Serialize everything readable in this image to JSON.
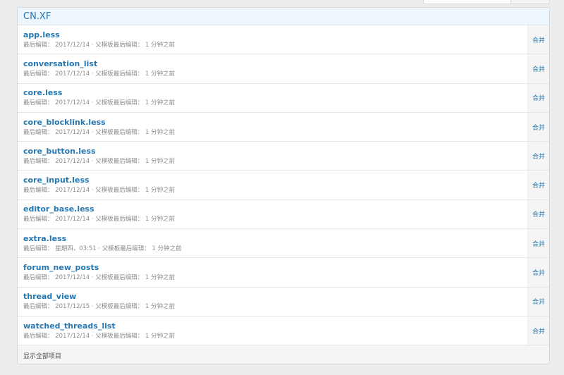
{
  "block": {
    "title": "CN.XF",
    "footer_link": "显示全部项目"
  },
  "items": [
    {
      "name": "app.less",
      "meta": "最后编辑： 2017/12/14 · 父模板最后编辑： 1 分钟之前",
      "action": "合并"
    },
    {
      "name": "conversation_list",
      "meta": "最后编辑： 2017/12/14 · 父模板最后编辑： 1 分钟之前",
      "action": "合并"
    },
    {
      "name": "core.less",
      "meta": "最后编辑： 2017/12/14 · 父模板最后编辑： 1 分钟之前",
      "action": "合并"
    },
    {
      "name": "core_blocklink.less",
      "meta": "最后编辑： 2017/12/14 · 父模板最后编辑： 1 分钟之前",
      "action": "合并"
    },
    {
      "name": "core_button.less",
      "meta": "最后编辑： 2017/12/14 · 父模板最后编辑： 1 分钟之前",
      "action": "合并"
    },
    {
      "name": "core_input.less",
      "meta": "最后编辑： 2017/12/14 · 父模板最后编辑： 1 分钟之前",
      "action": "合并"
    },
    {
      "name": "editor_base.less",
      "meta": "最后编辑： 2017/12/14 · 父模板最后编辑： 1 分钟之前",
      "action": "合并"
    },
    {
      "name": "extra.less",
      "meta": "最后编辑： 星期四，03:51 · 父模板最后编辑： 1 分钟之前",
      "action": "合并"
    },
    {
      "name": "forum_new_posts",
      "meta": "最后编辑： 2017/12/14 · 父模板最后编辑： 1 分钟之前",
      "action": "合并"
    },
    {
      "name": "thread_view",
      "meta": "最后编辑： 2017/12/15 · 父模板最后编辑： 1 分钟之前",
      "action": "合并"
    },
    {
      "name": "watched_threads_list",
      "meta": "最后编辑： 2017/12/14 · 父模板最后编辑： 1 分钟之前",
      "action": "合并"
    }
  ]
}
